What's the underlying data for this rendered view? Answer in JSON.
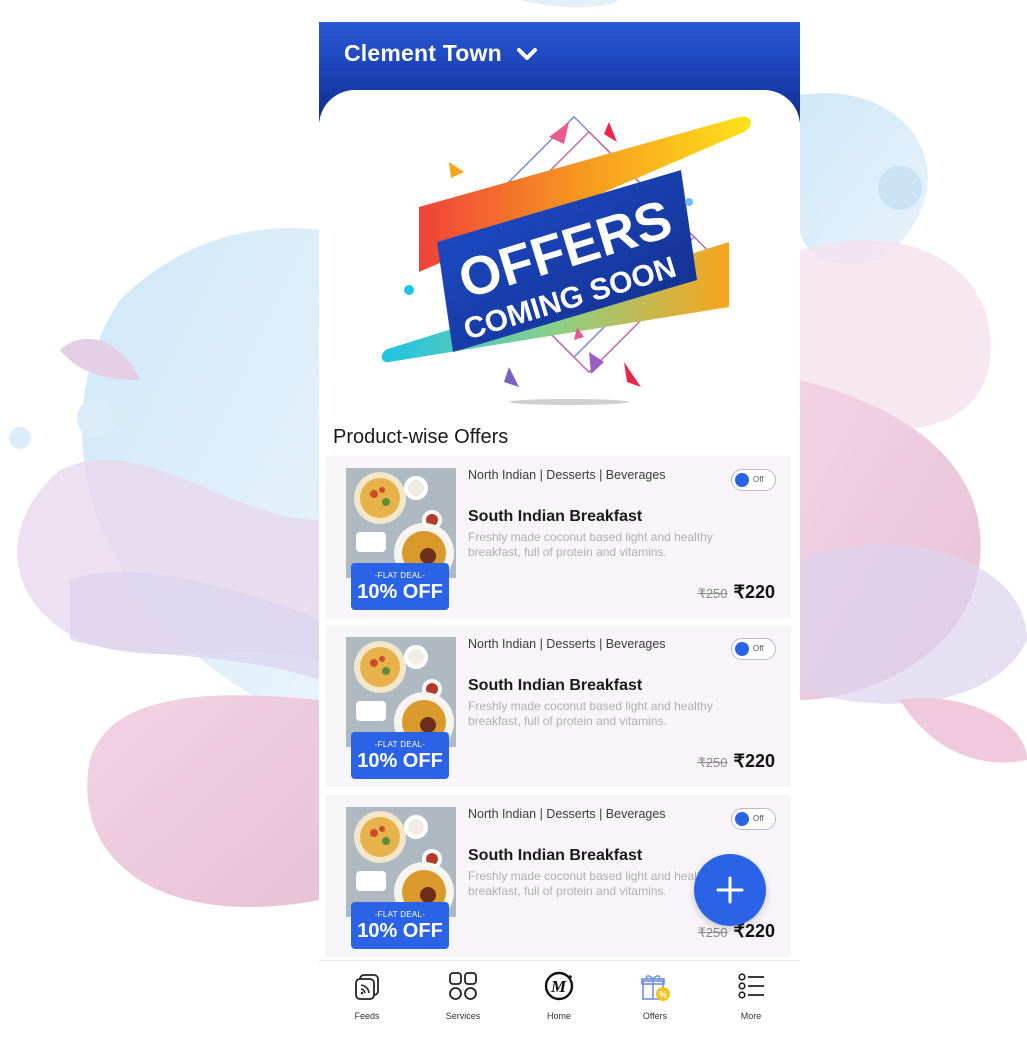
{
  "header": {
    "location": "Clement Town"
  },
  "banner": {
    "line1": "OFFERS",
    "line2": "COMING SOON"
  },
  "section": {
    "title": "Product-wise Offers"
  },
  "offers": [
    {
      "categories": "North Indian |  Desserts | Beverages",
      "toggle": "Off",
      "name": "South Indian Breakfast",
      "description": "Freshly made coconut based light and healthy breakfast, full of protein and vitamins.",
      "old_price": "₹250",
      "new_price": "₹220",
      "deal_label": "-FLAT DEAL-",
      "deal_value": "10% OFF"
    },
    {
      "categories": "North Indian |  Desserts | Beverages",
      "toggle": "Off",
      "name": "South Indian Breakfast",
      "description": "Freshly made coconut based light and healthy breakfast, full of protein and vitamins.",
      "old_price": "₹250",
      "new_price": "₹220",
      "deal_label": "-FLAT DEAL-",
      "deal_value": "10% OFF"
    },
    {
      "categories": "North Indian |  Desserts | Beverages",
      "toggle": "Off",
      "name": "South Indian Breakfast",
      "description": "Freshly made coconut based light and healthy breakfast, full of protein and vitamins.",
      "old_price": "₹250",
      "new_price": "₹220",
      "deal_label": "-FLAT DEAL-",
      "deal_value": "10% OFF"
    }
  ],
  "fab": {
    "icon": "plus-icon"
  },
  "nav": [
    {
      "label": "Feeds",
      "icon": "feeds-icon"
    },
    {
      "label": "Services",
      "icon": "services-grid-icon"
    },
    {
      "label": "Home",
      "icon": "home-logo-icon"
    },
    {
      "label": "Offers",
      "icon": "offers-gift-icon"
    },
    {
      "label": "More",
      "icon": "more-list-icon"
    }
  ],
  "colors": {
    "primary": "#2b63e6",
    "header": "#163aa8",
    "accent_orange": "#f7a51c",
    "accent_pink": "#e95a8f"
  }
}
